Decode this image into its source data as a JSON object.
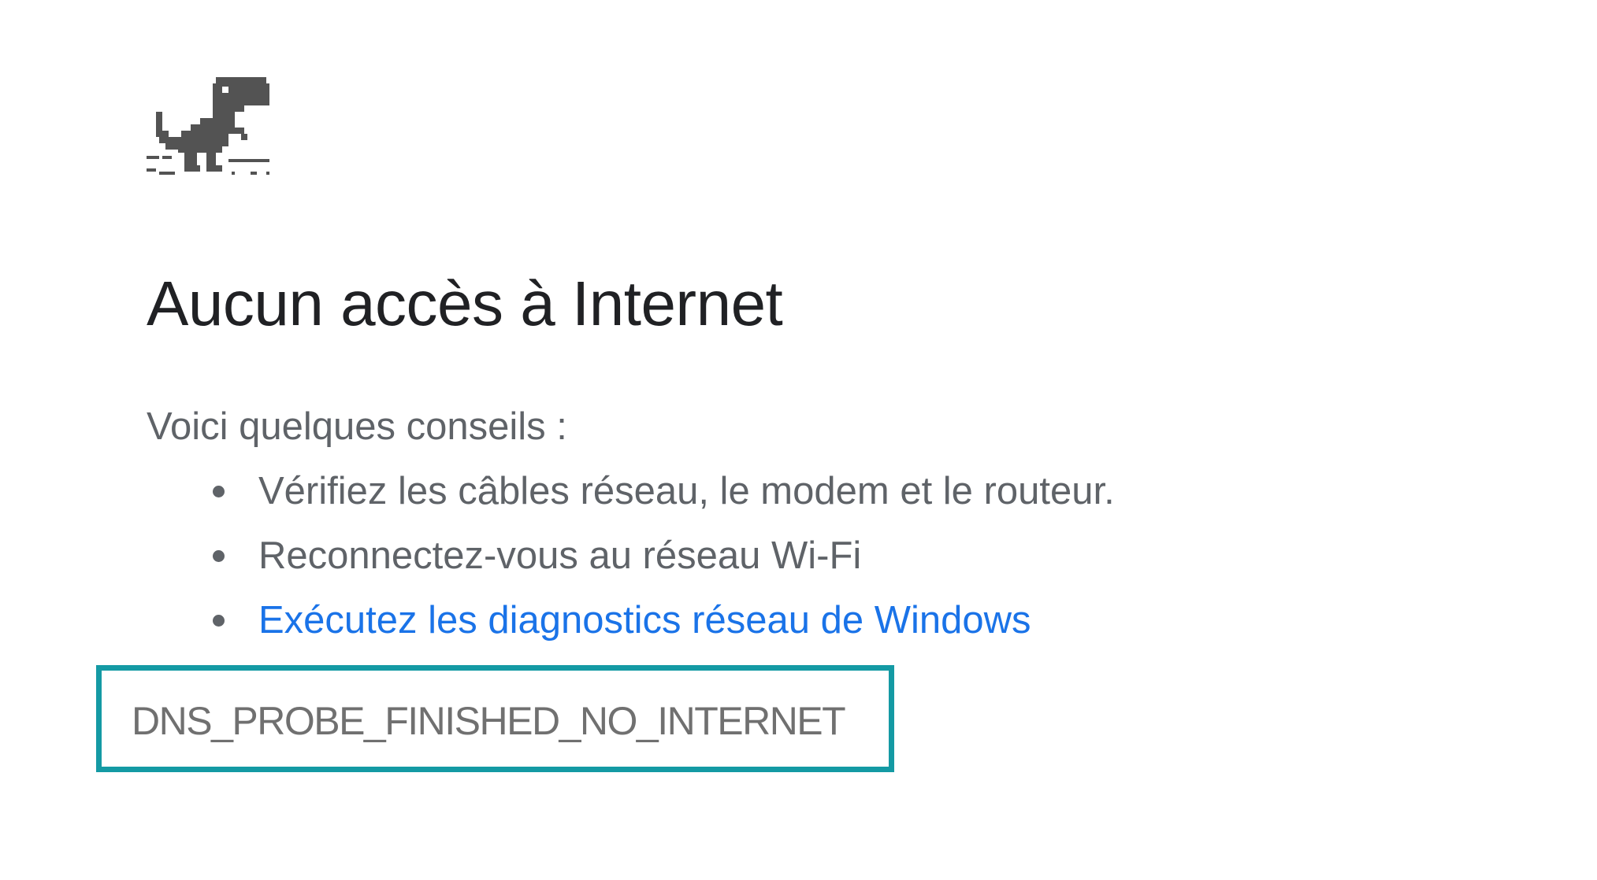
{
  "dino": {
    "icon": "offline-dinosaur-icon",
    "color": "#535353"
  },
  "heading": "Aucun accès à Internet",
  "suggestions": {
    "intro": "Voici quelques conseils :",
    "items": [
      {
        "label": "Vérifiez les câbles réseau, le modem et le routeur.",
        "is_link": false
      },
      {
        "label": "Reconnectez-vous au réseau Wi-Fi",
        "is_link": false
      },
      {
        "label": "Exécutez les diagnostics réseau de Windows",
        "is_link": true
      }
    ]
  },
  "error_code": "DNS_PROBE_FINISHED_NO_INTERNET",
  "colors": {
    "heading_text": "#202124",
    "body_text": "#5f6368",
    "link": "#1a73e8",
    "highlight_border": "#149aa4",
    "error_code_text": "#707070"
  }
}
